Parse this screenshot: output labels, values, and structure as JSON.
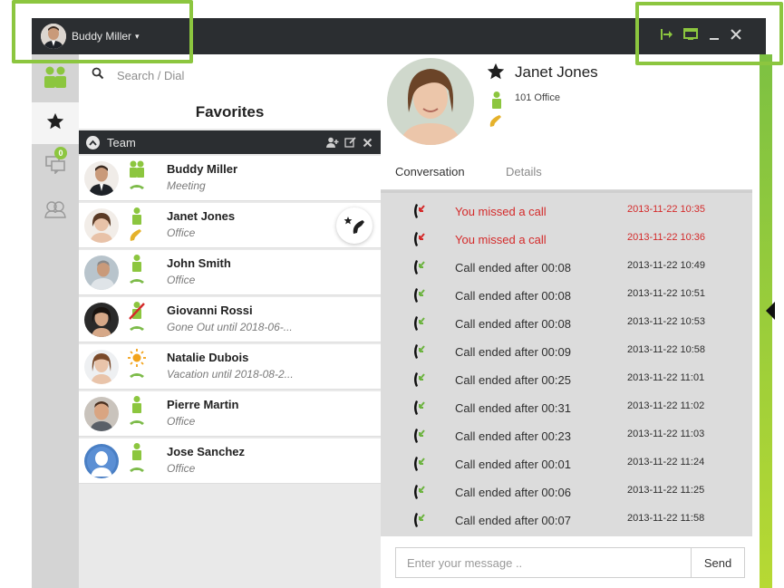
{
  "titlebar": {
    "user_name": "Buddy Miller",
    "caret": "▾"
  },
  "rail": {
    "chat_badge_count": "0"
  },
  "search": {
    "placeholder": "Search / Dial"
  },
  "favorites": {
    "title": "Favorites",
    "group_label": "Team"
  },
  "contacts": [
    {
      "name": "Buddy Miller",
      "status": "Meeting",
      "presence": "group"
    },
    {
      "name": "Janet Jones",
      "status": "Office",
      "presence": "available"
    },
    {
      "name": "John Smith",
      "status": "Office",
      "presence": "available"
    },
    {
      "name": "Giovanni Rossi",
      "status": "Gone Out until 2018-06-...",
      "presence": "away"
    },
    {
      "name": "Natalie Dubois",
      "status": "Vacation until 2018-08-2...",
      "presence": "vacation"
    },
    {
      "name": "Pierre Martin",
      "status": "Office",
      "presence": "available"
    },
    {
      "name": "Jose Sanchez",
      "status": "Office",
      "presence": "available"
    }
  ],
  "conversation": {
    "contact_name": "Janet Jones",
    "contact_extension": "101 Office",
    "tabs": [
      "Conversation",
      "Details"
    ],
    "log": [
      {
        "text": "You missed a call",
        "time": "2013-11-22 10:35",
        "type": "missed"
      },
      {
        "text": "You missed a call",
        "time": "2013-11-22 10:36",
        "type": "missed"
      },
      {
        "text": "Call ended after 00:08",
        "time": "2013-11-22 10:49",
        "type": "ended"
      },
      {
        "text": "Call ended after 00:08",
        "time": "2013-11-22 10:51",
        "type": "ended"
      },
      {
        "text": "Call ended after 00:08",
        "time": "2013-11-22 10:53",
        "type": "ended"
      },
      {
        "text": "Call ended after 00:09",
        "time": "2013-11-22 10:58",
        "type": "ended"
      },
      {
        "text": "Call ended after 00:25",
        "time": "2013-11-22 11:01",
        "type": "ended"
      },
      {
        "text": "Call ended after 00:31",
        "time": "2013-11-22 11:02",
        "type": "ended"
      },
      {
        "text": "Call ended after 00:23",
        "time": "2013-11-22 11:03",
        "type": "ended"
      },
      {
        "text": "Call ended after 00:01",
        "time": "2013-11-22 11:24",
        "type": "ended"
      },
      {
        "text": "Call ended after 00:06",
        "time": "2013-11-22 11:25",
        "type": "ended"
      },
      {
        "text": "Call ended after 00:07",
        "time": "2013-11-22 11:58",
        "type": "ended"
      }
    ],
    "message_placeholder": "Enter your message ..",
    "send_label": "Send"
  },
  "colors": {
    "accent": "#8cc63f",
    "titlebar": "#2b2e31",
    "missed": "#d42a2a",
    "ended_icon": "#6cb33f"
  }
}
